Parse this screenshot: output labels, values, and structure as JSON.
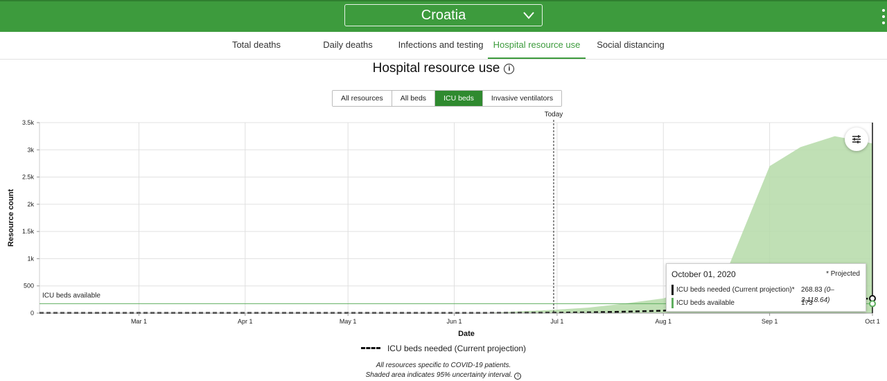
{
  "header": {
    "country": "Croatia",
    "country_icon": "chevron-down-icon",
    "menu_icon": "kebab-menu-icon"
  },
  "tabs": [
    {
      "label": "Total deaths",
      "active": false
    },
    {
      "label": "Daily deaths",
      "active": false
    },
    {
      "label": "Infections and testing",
      "active": false
    },
    {
      "label": "Hospital resource use",
      "active": true
    },
    {
      "label": "Social distancing",
      "active": false
    }
  ],
  "page_title": "Hospital resource use",
  "resource_buttons": [
    {
      "label": "All resources",
      "active": false
    },
    {
      "label": "All beds",
      "active": false
    },
    {
      "label": "ICU beds",
      "active": true
    },
    {
      "label": "Invasive ventilators",
      "active": false
    }
  ],
  "colors": {
    "brand_green": "#3d9b3d",
    "band_fill": "#b5dba8",
    "available_line": "#5fae5f"
  },
  "chart_data": {
    "type": "area",
    "xlabel": "Date",
    "ylabel": "Resource count",
    "x_domain": [
      "2020-02-01",
      "2020-10-01"
    ],
    "ylim": [
      0,
      3500
    ],
    "y_ticks": [
      0,
      500,
      1000,
      1500,
      2000,
      2500,
      3000,
      3500
    ],
    "y_tick_labels": [
      "0",
      "500",
      "1k",
      "1.5k",
      "2k",
      "2.5k",
      "3k",
      "3.5k"
    ],
    "x_ticks": [
      {
        "date": "2020-03-01",
        "label": "Mar 1"
      },
      {
        "date": "2020-04-01",
        "label": "Apr 1"
      },
      {
        "date": "2020-05-01",
        "label": "May 1"
      },
      {
        "date": "2020-06-01",
        "label": "Jun 1"
      },
      {
        "date": "2020-07-01",
        "label": "Jul 1"
      },
      {
        "date": "2020-08-01",
        "label": "Aug 1"
      },
      {
        "date": "2020-09-01",
        "label": "Sep 1"
      },
      {
        "date": "2020-10-01",
        "label": "Oct 1"
      }
    ],
    "grid": true,
    "today": {
      "date": "2020-06-30",
      "label": "Today"
    },
    "reference_line": {
      "value": 173,
      "label": "ICU beds available"
    },
    "series": [
      {
        "name": "ICU beds needed (Current projection)",
        "style": "dashed",
        "x": [
          "2020-02-01",
          "2020-06-10",
          "2020-06-30",
          "2020-07-10",
          "2020-07-20",
          "2020-08-01",
          "2020-08-10",
          "2020-08-20",
          "2020-09-01",
          "2020-09-10",
          "2020-09-20",
          "2020-10-01"
        ],
        "y": [
          2,
          4,
          8,
          14,
          25,
          45,
          80,
          125,
          180,
          220,
          250,
          268.83
        ],
        "band_upper": [
          2,
          4,
          60,
          100,
          170,
          270,
          450,
          850,
          2700,
          3050,
          3250,
          3118.64
        ],
        "band_lower": [
          0,
          0,
          0,
          0,
          0,
          0,
          0,
          0,
          0,
          0,
          0,
          0
        ]
      }
    ],
    "tooltip": {
      "date": "October 01, 2020",
      "projected_note": "* Projected",
      "needed_label": "ICU beds needed (Current projection)*",
      "needed_value": "268.83",
      "needed_range": "(0–3,118.64)",
      "available_label": "ICU beds available",
      "available_value": "173"
    }
  },
  "legend_label": "ICU beds needed (Current projection)",
  "notes": [
    "All resources specific to COVID-19 patients.",
    "Shaded area indicates 95% uncertainty interval."
  ]
}
